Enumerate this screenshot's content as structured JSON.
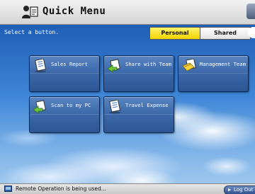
{
  "header": {
    "title": "Quick Menu",
    "icon": "person-with-document-icon"
  },
  "instruction": "Select a button.",
  "tabs": [
    {
      "label": "Personal",
      "active": true
    },
    {
      "label": "Shared",
      "active": false
    }
  ],
  "buttons": [
    {
      "label": "Sales Report",
      "icon": "document-icon"
    },
    {
      "label": "Share with Team",
      "icon": "send-document-icon"
    },
    {
      "label": "Management Team",
      "icon": "copy-document-icon"
    },
    {
      "label": "Scan to my PC",
      "icon": "send-document-icon"
    },
    {
      "label": "Travel Expense",
      "icon": "document-icon"
    }
  ],
  "status": {
    "message": "Remote Operation is being used...",
    "logout_label": "Log Out"
  },
  "colors": {
    "active_tab": "#f5d400",
    "button_fill": "#3d6aab",
    "sky": "#3e86d6"
  }
}
